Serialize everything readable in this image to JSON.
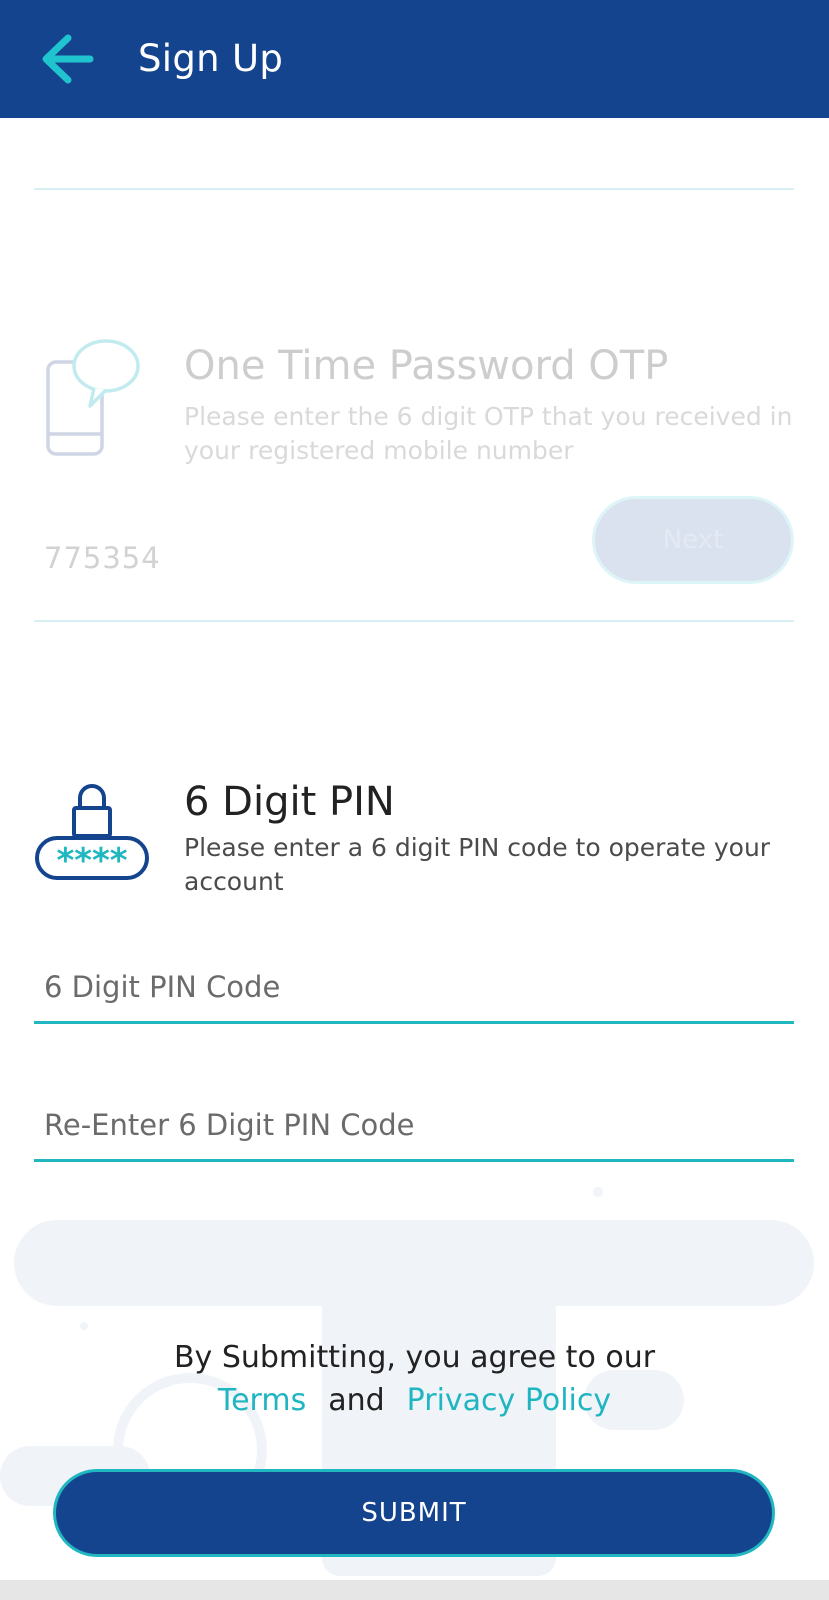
{
  "header": {
    "title": "Sign Up",
    "back_icon": "arrow-left-icon",
    "background": "#15448f",
    "accent": "#20b7c1"
  },
  "otp": {
    "icon": "phone-chat-icon",
    "title": "One Time Password OTP",
    "description": "Please enter the 6 digit OTP that you received in your registered mobile number",
    "value": "775354",
    "next_label": "Next"
  },
  "pin": {
    "icon": "lock-pin-icon",
    "icon_text": "****",
    "title": "6 Digit PIN",
    "description": "Please enter a 6 digit PIN code to operate your account",
    "pin_placeholder": "6 Digit PIN Code",
    "reenter_placeholder": "Re-Enter 6 Digit PIN Code"
  },
  "agreement": {
    "text": "By Submitting, you agree to our",
    "terms_label": "Terms",
    "and_label": "and",
    "privacy_label": "Privacy Policy"
  },
  "submit": {
    "label": "SUBMIT"
  }
}
